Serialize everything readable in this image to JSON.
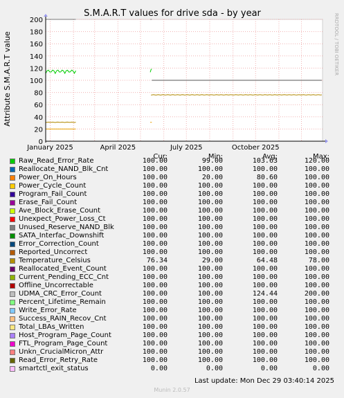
{
  "chart_data": {
    "type": "line",
    "title": "S.M.A.R.T values for drive sda - by year",
    "ylabel": "Attribute S.M.A.R.T value",
    "side_label": "RRDTOOL / TOBI OETIKER",
    "ylim": [
      0,
      200
    ],
    "yticks": [
      0,
      20,
      40,
      60,
      80,
      100,
      120,
      140,
      160,
      180,
      200
    ],
    "x_range": [
      "2024-12-04",
      "2024-12-29"
    ],
    "xticks": [
      {
        "date": "2025-01-01",
        "label": "January 2025"
      },
      {
        "date": "2025-04-01",
        "label": "April 2025"
      },
      {
        "date": "2025-07-01",
        "label": "July 2025"
      },
      {
        "date": "2025-10-01",
        "label": "October 2025"
      }
    ],
    "xlim": [
      "2024-12-26",
      "2025-12-29"
    ],
    "grid": true,
    "series": [
      {
        "name": "Raw_Read_Error_Rate",
        "color": "#00cc00",
        "type": "wiggle",
        "segments": [
          [
            "2024-12-26",
            "2025-02-04",
            114
          ],
          [
            "2025-05-14",
            "2025-05-16",
            116
          ]
        ]
      },
      {
        "name": "Power_On_Hours",
        "color": "#e8a000",
        "type": "line",
        "segments": [
          [
            "2024-12-26",
            "2025-02-04",
            20
          ],
          [
            "2025-05-14",
            "2025-05-16",
            31
          ]
        ]
      },
      {
        "name": "Temperature_Celsius",
        "color": "#b08800",
        "type": "wiggle",
        "segments": [
          [
            "2024-12-26",
            "2025-02-04",
            31
          ],
          [
            "2025-05-15",
            "2025-12-28",
            76
          ]
        ]
      },
      {
        "name": "Reallocate_NAND_Blk_Cnt",
        "color": "#555555",
        "type": "line",
        "segments": [
          [
            "2025-05-16",
            "2025-12-28",
            100
          ]
        ]
      },
      {
        "name": "UDMA_CRC_Error_Count",
        "color": "#777777",
        "type": "line",
        "segments": [
          [
            "2024-12-26",
            "2025-02-04",
            200
          ],
          [
            "2025-05-14",
            "2025-05-16",
            200
          ]
        ]
      },
      {
        "name": "smartctl_exit_status",
        "color": "#ffbbff",
        "type": "line",
        "segments": [
          [
            "2024-12-26",
            "2025-02-04",
            0
          ],
          [
            "2025-05-14",
            "2025-12-28",
            0
          ]
        ]
      }
    ]
  },
  "legend": {
    "headers": [
      "Cur:",
      "Min:",
      "Avg:",
      "Max:"
    ],
    "rows": [
      {
        "name": "Raw_Read_Error_Rate",
        "color": "#00cc00",
        "cur": "100.00",
        "min": "99.00",
        "avg": "103.63",
        "max": "120.00"
      },
      {
        "name": "Reallocate_NAND_Blk_Cnt",
        "color": "#0066b3",
        "cur": "100.00",
        "min": "100.00",
        "avg": "100.00",
        "max": "100.00"
      },
      {
        "name": "Power_On_Hours",
        "color": "#ff8000",
        "cur": "100.00",
        "min": "20.00",
        "avg": "80.60",
        "max": "100.00"
      },
      {
        "name": "Power_Cycle_Count",
        "color": "#ffcc00",
        "cur": "100.00",
        "min": "100.00",
        "avg": "100.00",
        "max": "100.00"
      },
      {
        "name": "Program_Fail_Count",
        "color": "#330099",
        "cur": "100.00",
        "min": "100.00",
        "avg": "100.00",
        "max": "100.00"
      },
      {
        "name": "Erase_Fail_Count",
        "color": "#990099",
        "cur": "100.00",
        "min": "100.00",
        "avg": "100.00",
        "max": "100.00"
      },
      {
        "name": "Ave_Block_Erase_Count",
        "color": "#ccff00",
        "cur": "100.00",
        "min": "100.00",
        "avg": "100.00",
        "max": "100.00"
      },
      {
        "name": "Unexpect_Power_Loss_Ct",
        "color": "#ff0000",
        "cur": "100.00",
        "min": "100.00",
        "avg": "100.00",
        "max": "100.00"
      },
      {
        "name": "Unused_Reserve_NAND_Blk",
        "color": "#808080",
        "cur": "100.00",
        "min": "100.00",
        "avg": "100.00",
        "max": "100.00"
      },
      {
        "name": "SATA_Interfac_Downshift",
        "color": "#008f00",
        "cur": "100.00",
        "min": "100.00",
        "avg": "100.00",
        "max": "100.00"
      },
      {
        "name": "Error_Correction_Count",
        "color": "#00487d",
        "cur": "100.00",
        "min": "100.00",
        "avg": "100.00",
        "max": "100.00"
      },
      {
        "name": "Reported_Uncorrect",
        "color": "#b35a00",
        "cur": "100.00",
        "min": "100.00",
        "avg": "100.00",
        "max": "100.00"
      },
      {
        "name": "Temperature_Celsius",
        "color": "#b38f00",
        "cur": "76.34",
        "min": "29.00",
        "avg": "64.48",
        "max": "78.00"
      },
      {
        "name": "Reallocated_Event_Count",
        "color": "#6b006b",
        "cur": "100.00",
        "min": "100.00",
        "avg": "100.00",
        "max": "100.00"
      },
      {
        "name": "Current_Pending_ECC_Cnt",
        "color": "#8fb300",
        "cur": "100.00",
        "min": "100.00",
        "avg": "100.00",
        "max": "100.00"
      },
      {
        "name": "Offline_Uncorrectable",
        "color": "#b30000",
        "cur": "100.00",
        "min": "100.00",
        "avg": "100.00",
        "max": "100.00"
      },
      {
        "name": "UDMA_CRC_Error_Count",
        "color": "#bebebe",
        "cur": "100.00",
        "min": "100.00",
        "avg": "124.44",
        "max": "200.00"
      },
      {
        "name": "Percent_Lifetime_Remain",
        "color": "#80ff80",
        "cur": "100.00",
        "min": "100.00",
        "avg": "100.00",
        "max": "100.00"
      },
      {
        "name": "Write_Error_Rate",
        "color": "#80c9ff",
        "cur": "100.00",
        "min": "100.00",
        "avg": "100.00",
        "max": "100.00"
      },
      {
        "name": "Success_RAIN_Recov_Cnt",
        "color": "#ffc080",
        "cur": "100.00",
        "min": "100.00",
        "avg": "100.00",
        "max": "100.00"
      },
      {
        "name": "Total_LBAs_Written",
        "color": "#ffe680",
        "cur": "100.00",
        "min": "100.00",
        "avg": "100.00",
        "max": "100.00"
      },
      {
        "name": "Host_Program_Page_Count",
        "color": "#aa80ff",
        "cur": "100.00",
        "min": "100.00",
        "avg": "100.00",
        "max": "100.00"
      },
      {
        "name": "FTL_Program_Page_Count",
        "color": "#ee00cc",
        "cur": "100.00",
        "min": "100.00",
        "avg": "100.00",
        "max": "100.00"
      },
      {
        "name": "Unkn_CrucialMicron_Attr",
        "color": "#ff8080",
        "cur": "100.00",
        "min": "100.00",
        "avg": "100.00",
        "max": "100.00"
      },
      {
        "name": "Read_Error_Retry_Rate",
        "color": "#666600",
        "cur": "100.00",
        "min": "100.00",
        "avg": "100.00",
        "max": "100.00"
      },
      {
        "name": "smartctl_exit_status",
        "color": "#ffbfff",
        "cur": "0.00",
        "min": "0.00",
        "avg": "0.00",
        "max": "0.00"
      }
    ]
  },
  "last_update": "Last update: Mon Dec 29 03:40:14 2025",
  "footer": "Munin 2.0.57"
}
